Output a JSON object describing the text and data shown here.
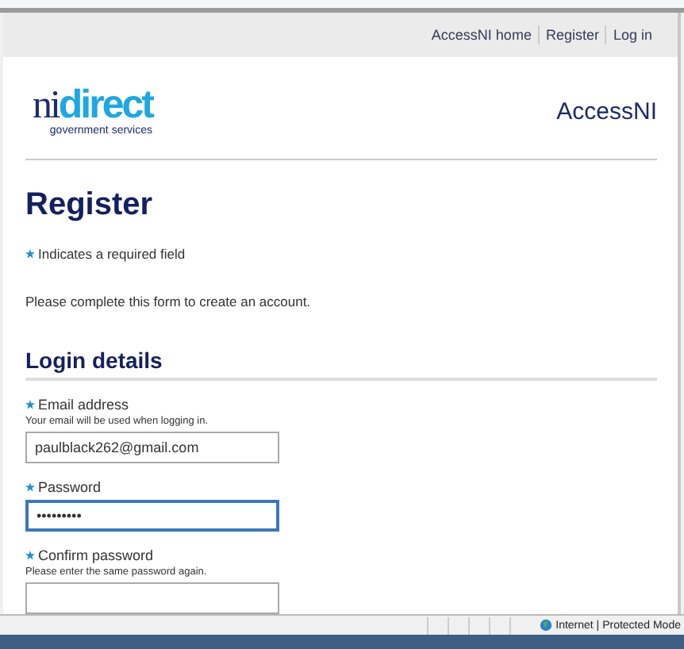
{
  "nav_links": [
    {
      "label": "AccessNI home"
    },
    {
      "label": "Register"
    },
    {
      "label": "Log in"
    }
  ],
  "logo": {
    "part_1": "ni",
    "part_2": "direct",
    "tagline": "government services"
  },
  "site_title": "AccessNI",
  "heading": "Register",
  "required_note": {
    "required": true,
    "text": "Indicates a required field"
  },
  "intro": "Please complete this form to create an account.",
  "section_title": "Login details",
  "fields": [
    {
      "label": "Email address",
      "required": true,
      "hint": "Your email will be used when logging in.",
      "value": "paulblack262@gmail.com",
      "focused": false
    },
    {
      "label": "Password",
      "required": true,
      "value": "•••••••••",
      "focused": true
    },
    {
      "label": "Confirm password",
      "required": true,
      "hint": "Please enter the same password again.",
      "focused": false
    }
  ],
  "status_bar": {
    "zone": "Internet | Protected Mode"
  }
}
